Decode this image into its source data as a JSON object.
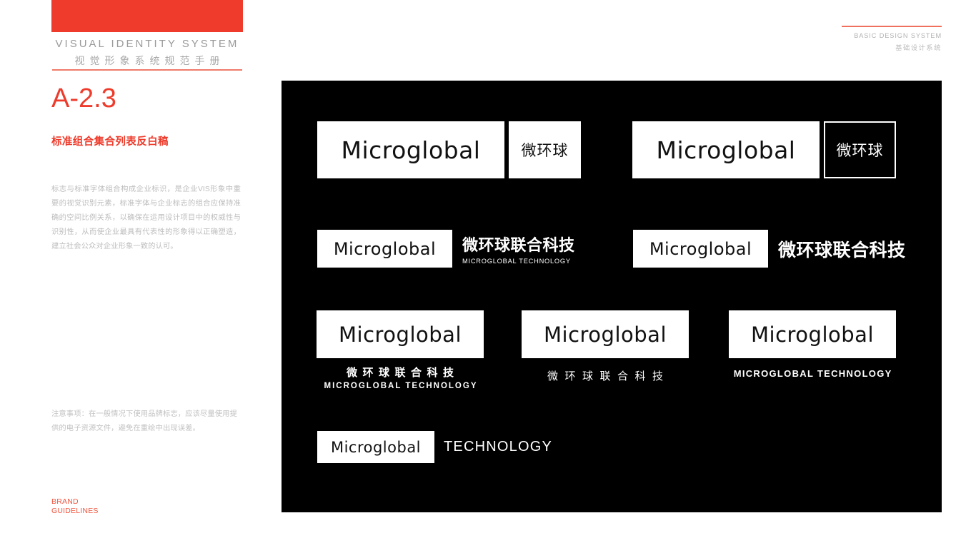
{
  "page": {
    "accent_color": "#ee3b2b",
    "panel_color": "#000000",
    "background_color": "#ffffff"
  },
  "left_column": {
    "vis_title_en": "VISUAL IDENTITY SYSTEM",
    "vis_title_cn": "视觉形象系统规范手册",
    "section_code": "A-2.3",
    "section_heading": "标准组合集合列表反白稿",
    "section_body": "标志与标准字体组合构成企业标识，是企业VIS形象中重要的视觉识别元素，标准字体与企业标志的组合应保持准确的空间比例关系，以确保在运用设计项目中的权威性与识别性，从而使企业最具有代表性的形象得以正确塑造，建立社会公众对企业形象一致的认可。",
    "section_note": "注意事项：在一般情况下使用品牌标志，应该尽量使用提供的电子资源文件，避免在重绘中出现误差。",
    "footer_brand_line1": "BRAND",
    "footer_brand_line2": "GUIDELINES"
  },
  "header_right": {
    "title_en": "BASIC DESIGN SYSTEM",
    "title_cn": "基础设计系统"
  },
  "showcase": {
    "wordmark": "Microglobal",
    "lockups": [
      {
        "id": "lockup-1",
        "variant": "wordmark-plate-plus-cn-plate",
        "wordmark": "Microglobal",
        "cn_short": "微环球"
      },
      {
        "id": "lockup-2",
        "variant": "wordmark-plate-plus-cn-outline-plate",
        "wordmark": "Microglobal",
        "cn_short": "微环球"
      },
      {
        "id": "lockup-3",
        "variant": "wordmark-plate-plus-side-cn-and-en",
        "wordmark": "Microglobal",
        "cn_full": "微环球联合科技",
        "en_full": "MICROGLOBAL TECHNOLOGY"
      },
      {
        "id": "lockup-4",
        "variant": "wordmark-plate-plus-side-cn",
        "wordmark": "Microglobal",
        "cn_full": "微环球联合科技"
      },
      {
        "id": "lockup-5",
        "variant": "stacked-cn-and-en",
        "wordmark": "Microglobal",
        "cn_full": "微环球联合科技",
        "en_full": "MICROGLOBAL TECHNOLOGY"
      },
      {
        "id": "lockup-6",
        "variant": "stacked-cn-only",
        "wordmark": "Microglobal",
        "cn_full": "微环球联合科技"
      },
      {
        "id": "lockup-7",
        "variant": "stacked-en-only",
        "wordmark": "Microglobal",
        "en_full": "MICROGLOBAL TECHNOLOGY"
      },
      {
        "id": "lockup-8",
        "variant": "wordmark-plate-plus-side-en-word",
        "wordmark": "Microglobal",
        "en_word": "TECHNOLOGY"
      }
    ]
  }
}
